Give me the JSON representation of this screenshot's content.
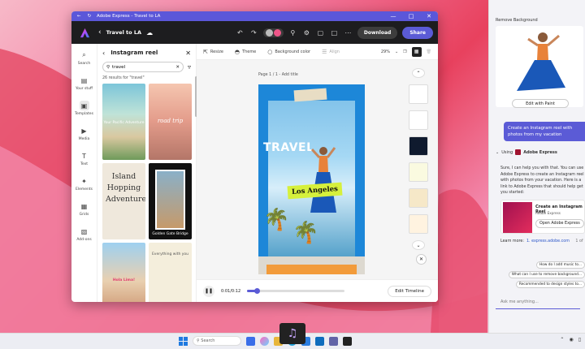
{
  "window": {
    "title": "Adobe Express - Travel to LA",
    "caps": [
      "—",
      "□",
      "✕"
    ]
  },
  "appbar": {
    "doc_title": "Travel to LA",
    "download_label": "Download",
    "share_label": "Share"
  },
  "rail": [
    {
      "label": "Search",
      "icon": "⌕"
    },
    {
      "label": "Your stuff",
      "icon": "▤"
    },
    {
      "label": "Templates",
      "icon": "▣"
    },
    {
      "label": "Media",
      "icon": "▶"
    },
    {
      "label": "Text",
      "icon": "T"
    },
    {
      "label": "Elements",
      "icon": "✦"
    },
    {
      "label": "Grids",
      "icon": "▦"
    },
    {
      "label": "Add-ons",
      "icon": "▧"
    }
  ],
  "panel": {
    "title": "Instagram reel",
    "search_value": "travel",
    "results": "26 results for \"travel\"",
    "thumbs": [
      {
        "caption": "Your Pacific Adventure"
      },
      {
        "caption": "road trip"
      },
      {
        "caption": "Island Hopping Adventures"
      },
      {
        "caption": "Golden Gate Bridge"
      },
      {
        "caption": "Hola Lima!"
      },
      {
        "caption": "Everything with you"
      }
    ]
  },
  "toolbar": {
    "resize": "Resize",
    "theme": "Theme",
    "bg_color": "Background color",
    "align": "Align",
    "zoom": "29%"
  },
  "canvas": {
    "page_label": "Page 1 / 1 - Add title",
    "travel": "TRAVEL",
    "location": "Los Angeles"
  },
  "timeline": {
    "time": "0:01/0:12",
    "progress": 0.1,
    "edit_label": "Edit Timeline"
  },
  "side": {
    "rb_title": "Remove Background",
    "rb_btn": "Edit with Paint",
    "user_msg": "Create an Instagram reel with photos from my vacation",
    "using_label": "Using",
    "using_app": "Adobe Express",
    "bot_text": "Sure, I can help you with that. You can use Adobe Express to create an Instagram reel with photos from your vacation. Here is a link to Adobe Express that should help get you started:",
    "card_title": "Create an Instagram Reel",
    "card_sub": "Adobe Express",
    "card_btn": "Open Adobe Express",
    "learn_label": "Learn more:",
    "learn_link": "1. express.adobe.com",
    "learn_count": "1 of",
    "suggestions": [
      "How do I add music to...",
      "What can I use to remove background...",
      "Recommended to design styles to..."
    ],
    "ask_placeholder": "Ask me anything..."
  },
  "taskbar": {
    "search": "Search"
  },
  "colors": {
    "accent": "#5b5bd6",
    "appbar": "#1d1d1f",
    "titlebar": "#5b57d9",
    "artboard": "#1d87d8",
    "highlight": "#d6f03c"
  }
}
